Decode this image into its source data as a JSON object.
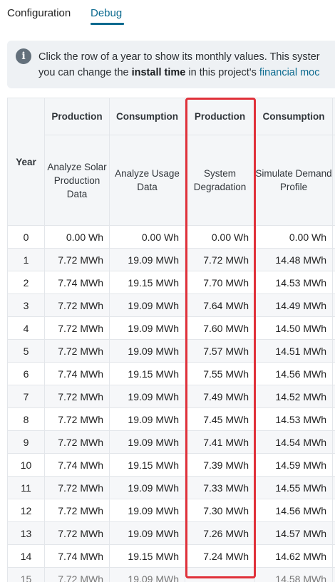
{
  "tabs": [
    {
      "label": "Configuration",
      "active": false
    },
    {
      "label": "Debug",
      "active": true
    }
  ],
  "info": {
    "icon": "info-icon",
    "line1": "Click the row of a year to show its monthly values. This syster",
    "line2_pre": "you can change the ",
    "line2_bold": "install time",
    "line2_mid": " in this project's ",
    "line2_link": "financial moc"
  },
  "table": {
    "group_headers": [
      "",
      "Production",
      "Consumption",
      "Production",
      "Consumption",
      ""
    ],
    "column_headers": [
      "Year",
      "Analyze Solar Production Data",
      "Analyze Usage Data",
      "System Degradation",
      "Simulate Demand Profile",
      ""
    ],
    "rows": [
      {
        "year": "0",
        "c1": "0.00 Wh",
        "c2": "0.00 Wh",
        "c3": "0.00 Wh",
        "c4": "0.00 Wh"
      },
      {
        "year": "1",
        "c1": "7.72 MWh",
        "c2": "19.09 MWh",
        "c3": "7.72 MWh",
        "c4": "14.48 MWh"
      },
      {
        "year": "2",
        "c1": "7.74 MWh",
        "c2": "19.15 MWh",
        "c3": "7.70 MWh",
        "c4": "14.53 MWh"
      },
      {
        "year": "3",
        "c1": "7.72 MWh",
        "c2": "19.09 MWh",
        "c3": "7.64 MWh",
        "c4": "14.49 MWh"
      },
      {
        "year": "4",
        "c1": "7.72 MWh",
        "c2": "19.09 MWh",
        "c3": "7.60 MWh",
        "c4": "14.50 MWh"
      },
      {
        "year": "5",
        "c1": "7.72 MWh",
        "c2": "19.09 MWh",
        "c3": "7.57 MWh",
        "c4": "14.51 MWh"
      },
      {
        "year": "6",
        "c1": "7.74 MWh",
        "c2": "19.15 MWh",
        "c3": "7.55 MWh",
        "c4": "14.56 MWh"
      },
      {
        "year": "7",
        "c1": "7.72 MWh",
        "c2": "19.09 MWh",
        "c3": "7.49 MWh",
        "c4": "14.52 MWh"
      },
      {
        "year": "8",
        "c1": "7.72 MWh",
        "c2": "19.09 MWh",
        "c3": "7.45 MWh",
        "c4": "14.53 MWh"
      },
      {
        "year": "9",
        "c1": "7.72 MWh",
        "c2": "19.09 MWh",
        "c3": "7.41 MWh",
        "c4": "14.54 MWh"
      },
      {
        "year": "10",
        "c1": "7.74 MWh",
        "c2": "19.15 MWh",
        "c3": "7.39 MWh",
        "c4": "14.59 MWh"
      },
      {
        "year": "11",
        "c1": "7.72 MWh",
        "c2": "19.09 MWh",
        "c3": "7.33 MWh",
        "c4": "14.55 MWh"
      },
      {
        "year": "12",
        "c1": "7.72 MWh",
        "c2": "19.09 MWh",
        "c3": "7.30 MWh",
        "c4": "14.56 MWh"
      },
      {
        "year": "13",
        "c1": "7.72 MWh",
        "c2": "19.09 MWh",
        "c3": "7.26 MWh",
        "c4": "14.57 MWh"
      },
      {
        "year": "14",
        "c1": "7.74 MWh",
        "c2": "19.15 MWh",
        "c3": "7.24 MWh",
        "c4": "14.62 MWh"
      },
      {
        "year": "15",
        "c1": "7.72 MWh",
        "c2": "19.09 MWh",
        "c3": "",
        "c4": "14.58 MWh"
      }
    ]
  },
  "highlight_color": "#e0313a"
}
